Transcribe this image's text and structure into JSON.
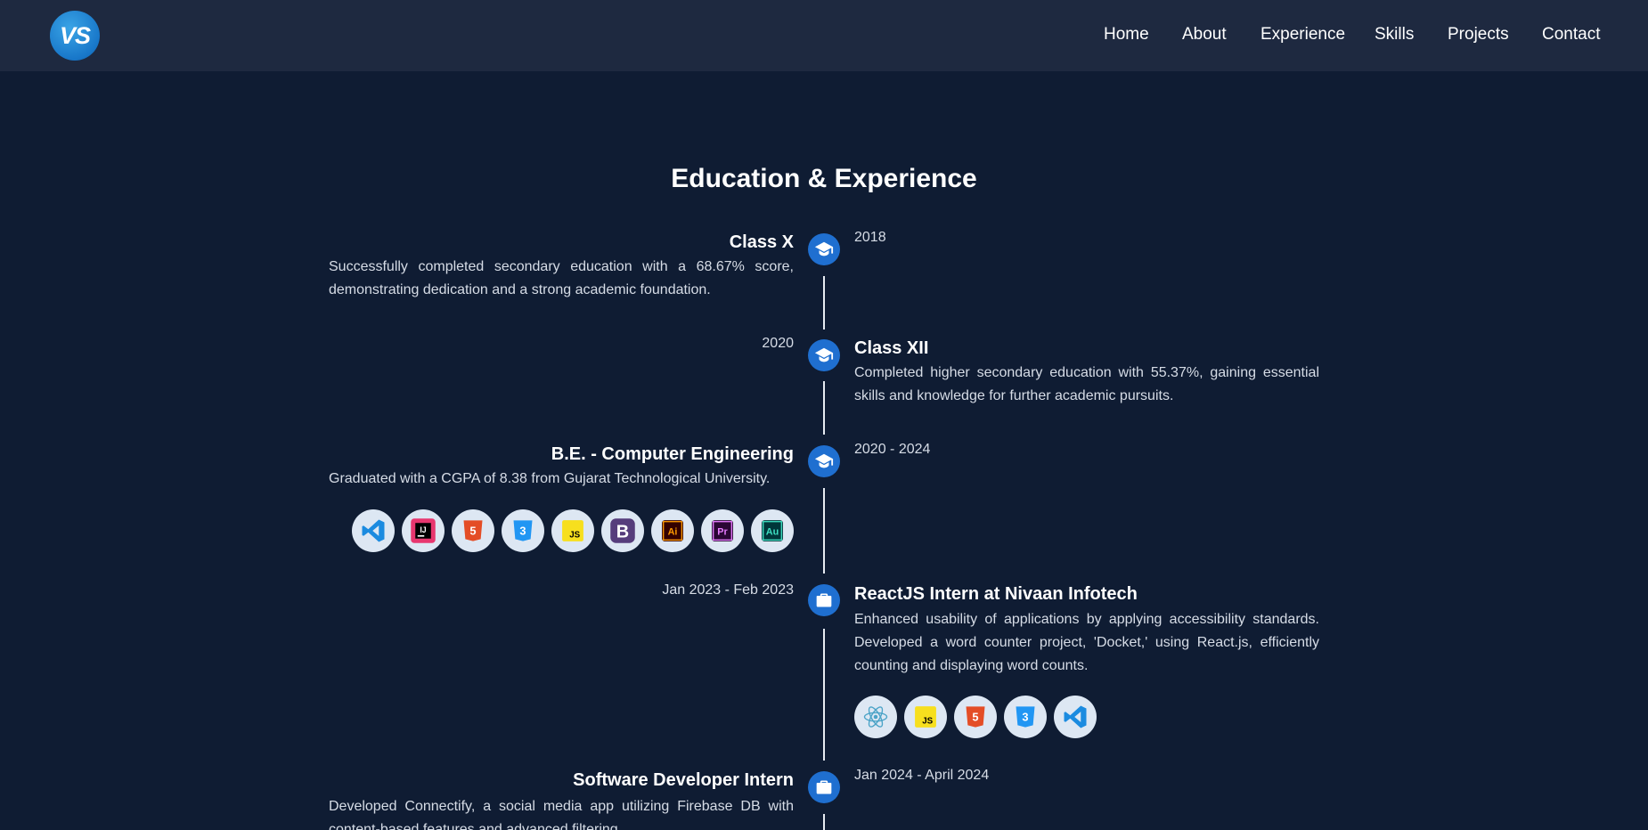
{
  "brand": {
    "logo_text": "VS"
  },
  "nav": {
    "items": [
      "Home",
      "About",
      "Experience",
      "Skills",
      "Projects",
      "Contact"
    ]
  },
  "section": {
    "title": "Education & Experience"
  },
  "timeline": [
    {
      "title": "Class X",
      "date": "2018",
      "description": "Successfully completed secondary education with a 68.67% score, demonstrating dedication and a strong academic foundation.",
      "icon": "graduation-cap-icon"
    },
    {
      "title": "Class XII",
      "date": "2020",
      "description": "Completed higher secondary education with 55.37%, gaining essential skills and knowledge for further academic pursuits.",
      "icon": "graduation-cap-icon"
    },
    {
      "title": "B.E. - Computer Engineering",
      "date": "2020 - 2024",
      "description": "Graduated with a CGPA of 8.38 from Gujarat Technological University.",
      "icon": "graduation-cap-icon",
      "tech": [
        {
          "name": "vscode-icon",
          "label": ""
        },
        {
          "name": "intellij-icon",
          "label": "IJ"
        },
        {
          "name": "html5-icon",
          "label": "5"
        },
        {
          "name": "css3-icon",
          "label": "3"
        },
        {
          "name": "javascript-icon",
          "label": "JS"
        },
        {
          "name": "bootstrap-icon",
          "label": "B"
        },
        {
          "name": "illustrator-icon",
          "label": "Ai"
        },
        {
          "name": "premiere-pro-icon",
          "label": "Pr"
        },
        {
          "name": "audition-icon",
          "label": "Au"
        }
      ]
    },
    {
      "title": "ReactJS Intern at Nivaan Infotech",
      "date": "Jan 2023 - Feb 2023",
      "description": "Enhanced usability of applications by applying accessibility standards. Developed a word counter project, 'Docket,' using React.js, efficiently counting and displaying word counts.",
      "icon": "briefcase-icon",
      "tech": [
        {
          "name": "react-icon",
          "label": ""
        },
        {
          "name": "javascript-icon",
          "label": "JS"
        },
        {
          "name": "html5-icon",
          "label": "5"
        },
        {
          "name": "css3-icon",
          "label": "3"
        },
        {
          "name": "vscode-icon",
          "label": ""
        }
      ]
    },
    {
      "title": "Software Developer Intern",
      "date": "Jan 2024 - April 2024",
      "description": "Developed Connectify, a social media app utilizing Firebase DB with content-based features and advanced filtering.",
      "icon": "briefcase-icon"
    }
  ],
  "colors": {
    "background": "#0f1c33",
    "header": "#1e2940",
    "accent": "#1f6fd0",
    "chip": "#dde7f3"
  }
}
